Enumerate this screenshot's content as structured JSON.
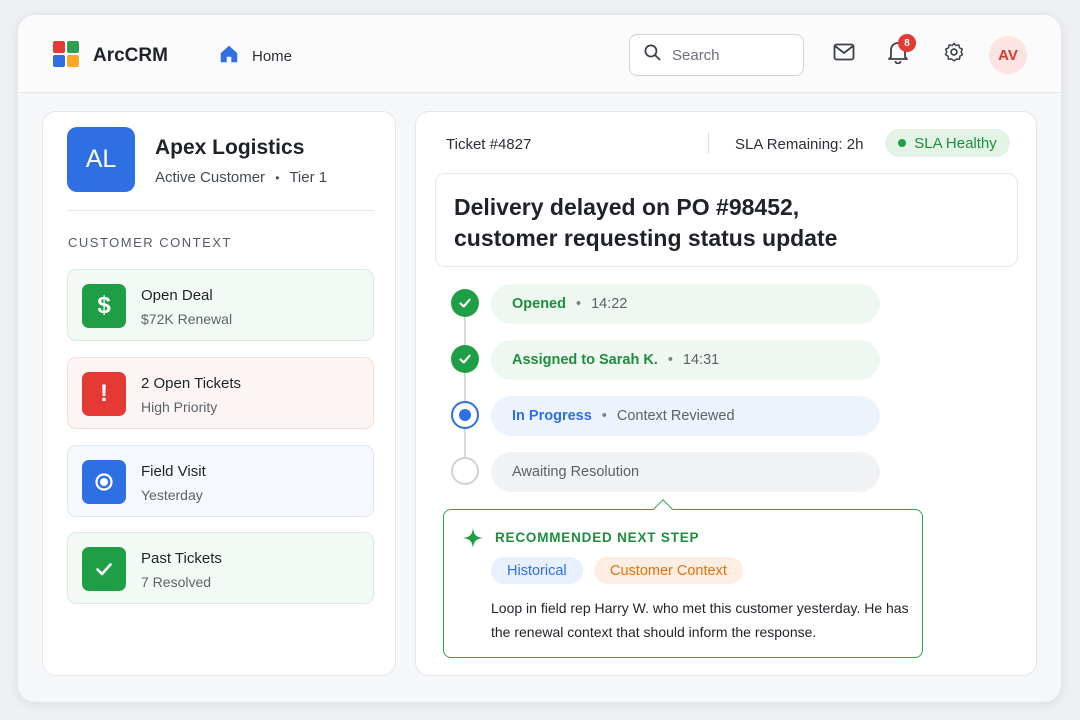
{
  "app": {
    "brand": "ArcCRM",
    "logo_colors": [
      "#e53935",
      "#2e9e4f",
      "#2f6fe4",
      "#f9a825"
    ]
  },
  "nav": {
    "home_label": "Home"
  },
  "search": {
    "placeholder": "Search"
  },
  "header_icons": [
    "mail-icon",
    "bell-icon",
    "gear-icon"
  ],
  "notifications": {
    "count": "8"
  },
  "user": {
    "initials": "AV"
  },
  "customer": {
    "initials": "AL",
    "name": "Apex Logistics",
    "status": "Active Customer",
    "tier": "Tier 1",
    "sub_separator": "•"
  },
  "context": {
    "heading": "CUSTOMER CONTEXT",
    "items": [
      {
        "title": "Open Deal",
        "desc": "$72K Renewal",
        "icon": "dollar-icon",
        "glyph": "$",
        "icon_color": "#1e9e45",
        "bg": "#f3faf5",
        "border": "#d7ecdc"
      },
      {
        "title": "2 Open Tickets",
        "desc": "High Priority",
        "icon": "alert-icon",
        "glyph": "!",
        "icon_color": "#e53935",
        "bg": "#fdf5f4",
        "border": "#f4dcd9"
      },
      {
        "title": "Field Visit",
        "desc": "Yesterday",
        "icon": "location-icon",
        "glyph": "",
        "icon_color": "#2f6fe4",
        "bg": "#f5f8fd",
        "border": "#dfe6f2"
      },
      {
        "title": "Past Tickets",
        "desc": "7 Resolved",
        "icon": "check-icon",
        "glyph": "",
        "icon_color": "#1e9e45",
        "bg": "#f3faf5",
        "border": "#d7ecdc"
      }
    ]
  },
  "ticket": {
    "id": "Ticket #4827",
    "sla_remaining": "SLA Remaining: 2h",
    "sla_status": "SLA Healthy",
    "headline": "Delivery delayed on PO #98452,\ncustomer requesting status update"
  },
  "timeline": [
    {
      "label": "Opened",
      "separator": "•",
      "meta": "14:22",
      "state": "done"
    },
    {
      "label": "Assigned to Sarah K.",
      "separator": "•",
      "meta": "14:31",
      "state": "done"
    },
    {
      "label": "In Progress",
      "separator": "•",
      "meta": "Context Reviewed",
      "state": "active"
    },
    {
      "label": "Awaiting Resolution",
      "separator": "",
      "meta": "",
      "state": "pending"
    }
  ],
  "recommendation": {
    "title": "RECOMMENDED NEXT STEP",
    "tags": [
      "Historical",
      "Customer Context"
    ],
    "body": "Loop in field rep Harry W. who met this customer yesterday. He has the renewal context that should inform the response."
  },
  "colors": {
    "accent_green": "#1e8e3e",
    "accent_blue": "#2f6fe4",
    "alert_red": "#e53935",
    "tag_orange": "#e8710a"
  }
}
